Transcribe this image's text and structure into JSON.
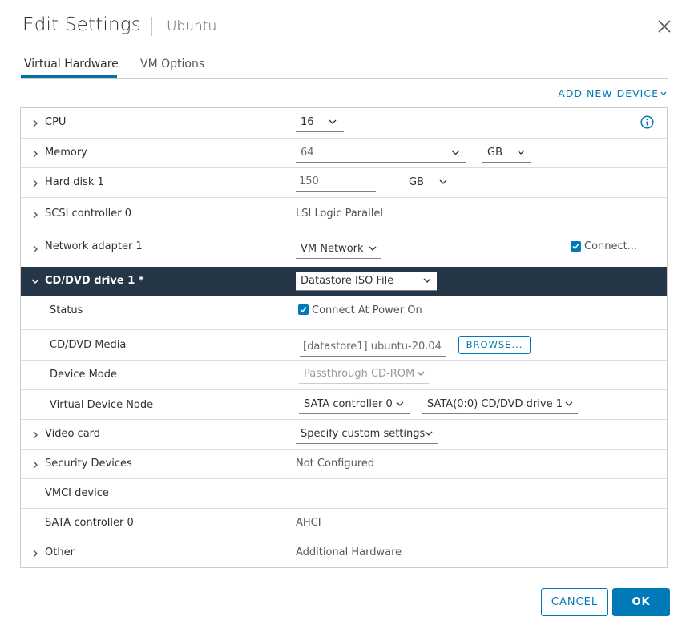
{
  "header": {
    "title": "Edit Settings",
    "subtitle": "Ubuntu",
    "close_icon": "close-icon"
  },
  "tabs": [
    {
      "label": "Virtual Hardware",
      "active": true
    },
    {
      "label": "VM Options",
      "active": false
    }
  ],
  "add_device": {
    "label": "ADD NEW DEVICE",
    "icon": "chevron-down-icon"
  },
  "rows": {
    "cpu": {
      "label": "CPU",
      "value": "16"
    },
    "memory": {
      "label": "Memory",
      "value": "64",
      "unit": "GB"
    },
    "hard_disk": {
      "label": "Hard disk 1",
      "value": "150",
      "unit": "GB"
    },
    "scsi": {
      "label": "SCSI controller 0",
      "value": "LSI Logic Parallel"
    },
    "network": {
      "label": "Network adapter 1",
      "value": "VM Network",
      "connect_label": "Connect...",
      "connect_checked": true
    },
    "cddvd": {
      "label": "CD/DVD drive 1 *",
      "value": "Datastore ISO File",
      "status": {
        "label": "Status",
        "checkbox_label": "Connect At Power On",
        "checked": true
      },
      "media": {
        "label": "CD/DVD Media",
        "value": "[datastore1] ubuntu-20.04",
        "browse_label": "BROWSE..."
      },
      "device_mode": {
        "label": "Device Mode",
        "value": "Passthrough CD-ROM"
      },
      "node": {
        "label": "Virtual Device Node",
        "controller": "SATA controller 0",
        "drive": "SATA(0:0) CD/DVD drive 1"
      }
    },
    "video": {
      "label": "Video card",
      "value": "Specify custom settings"
    },
    "security": {
      "label": "Security Devices",
      "value": "Not Configured"
    },
    "vmci": {
      "label": "VMCI device"
    },
    "sata": {
      "label": "SATA controller 0",
      "value": "AHCI"
    },
    "other": {
      "label": "Other",
      "value": "Additional Hardware"
    }
  },
  "footer": {
    "cancel_label": "CANCEL",
    "ok_label": "OK"
  },
  "colors": {
    "accent": "#0079b8",
    "expanded_row_bg": "#253746"
  }
}
